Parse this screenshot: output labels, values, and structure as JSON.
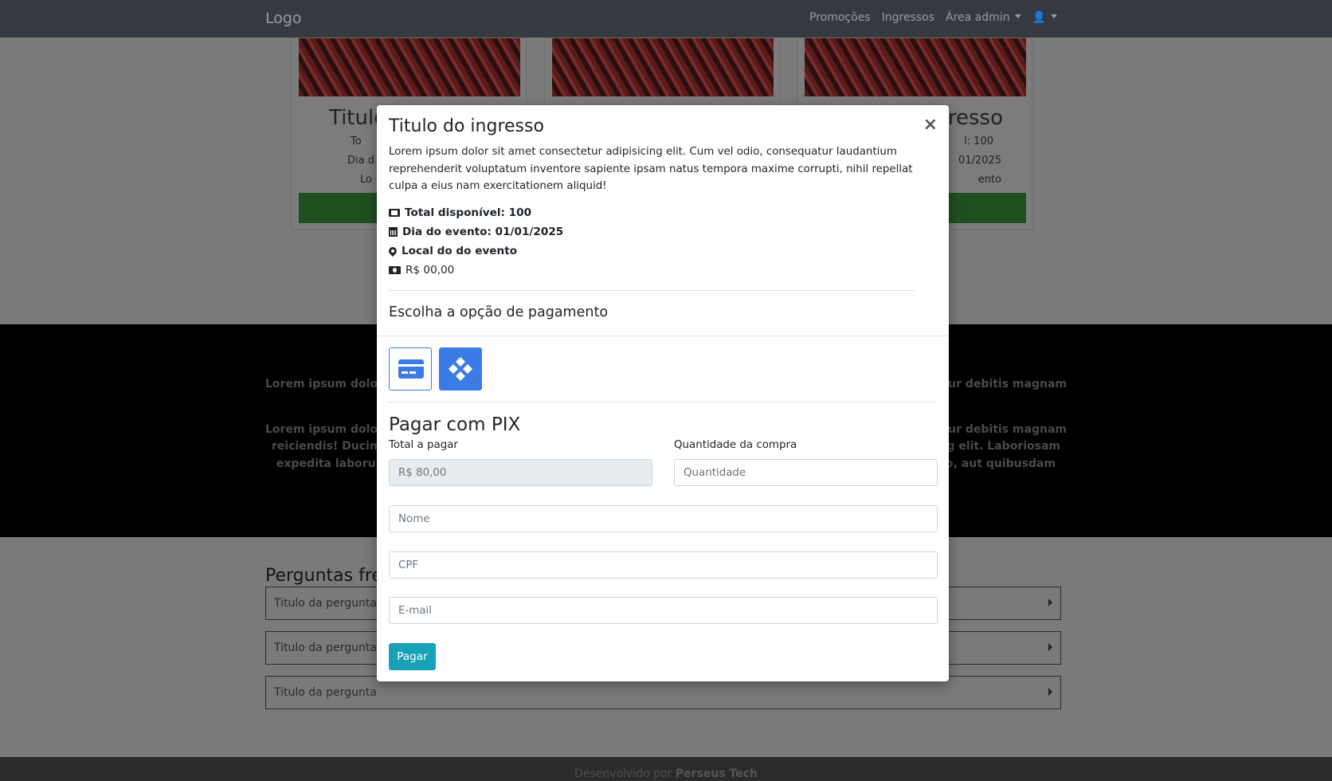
{
  "navbar": {
    "logo": "Logo",
    "links": [
      "Promoções",
      "Ingressos",
      "Área admin"
    ]
  },
  "cards": [
    {
      "title": "Titulo",
      "lines": [
        "To",
        "Dia d",
        "Lo"
      ]
    },
    {
      "title": "",
      "lines": [
        "",
        "",
        ""
      ]
    },
    {
      "title": "resso",
      "lines": [
        "l: 100",
        "01/2025",
        "ento"
      ]
    }
  ],
  "mid": {
    "line1_left": "Lorem ipsum dolor s",
    "line1_right": "etur debitis magnam",
    "para_left": [
      "Lorem ipsum dolor s",
      "reiciendis! Ducimus",
      "expedita laborum m"
    ],
    "para_right": [
      "etur debitis magnam",
      "icing elit. Laboriosam",
      "ctio, aut quibusdam"
    ]
  },
  "faq": {
    "title": "Perguntas fre",
    "items": [
      "Titulo da pergunta",
      "Titulo da pergunta",
      "Titulo da pergunta"
    ]
  },
  "footer": {
    "prefix": "Desenvolvido por",
    "brand": "Perseus Tech"
  },
  "modal": {
    "title": "Titulo do ingresso",
    "close": "×",
    "description": "Lorem ipsum dolor sit amet consectetur adipisicing elit. Cum vel odio, consequatur laudantium reprehenderit voluptatum inventore sapiente ipsam natus tempora maxime corrupti, nihil repellat culpa a eius nam exercitationem aliquid!",
    "total_disponivel": "Total disponível: 100",
    "dia_evento": "Dia do evento: 01/01/2025",
    "local": "Local do do evento",
    "preco": "R$ 00,00",
    "payment_heading": "Escolha a opção de pagamento",
    "payment_options": [
      "credit-card",
      "pix"
    ],
    "pix_heading": "Pagar com PIX",
    "total_label": "Total a pagar",
    "total_value": "R$ 80,00",
    "quantidade_label": "Quantidade da compra",
    "quantidade_placeholder": "Quantidade",
    "nome_placeholder": "Nome",
    "cpf_placeholder": "CPF",
    "email_placeholder": "E-mail",
    "pay_button": "Pagar"
  },
  "colors": {
    "accent": "#3b7be6",
    "pay_button": "#17a2b8",
    "navbar": "#343a40"
  }
}
